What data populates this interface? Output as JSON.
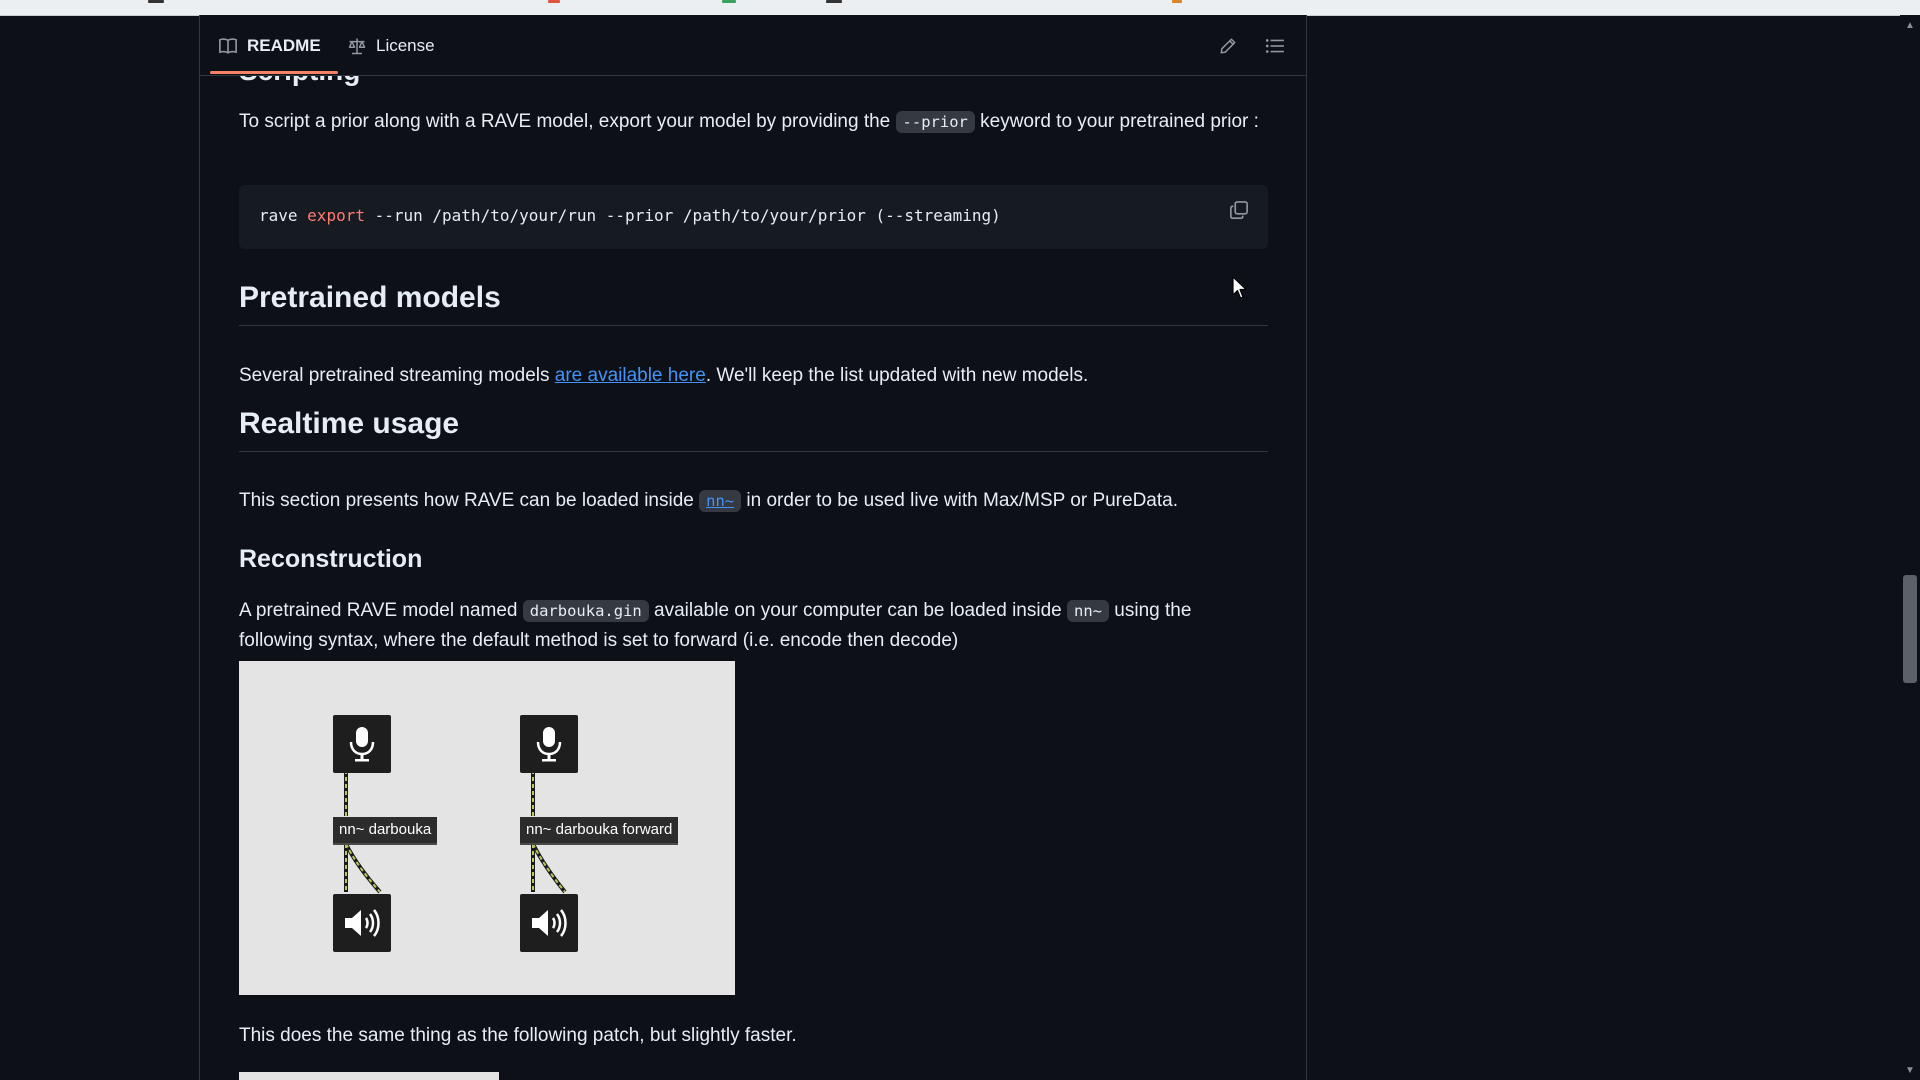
{
  "tabs": {
    "readme_label": "README",
    "license_label": "License"
  },
  "toolbar": {
    "edit_icon": "pencil-icon",
    "outline_icon": "list-icon"
  },
  "partial_heading": "Scripting",
  "scripting": {
    "text_before": "To script a prior along with a RAVE model, export your model by providing the ",
    "code": "--prior",
    "text_after": " keyword to your pretrained prior :"
  },
  "code_block": {
    "cmd": "rave",
    "keyword": "export",
    "rest": " --run /path/to/your/run --prior /path/to/your/prior (--streaming)",
    "copy_icon": "copy-icon"
  },
  "pretrained": {
    "heading": "Pretrained models",
    "text_before": "Several pretrained streaming models ",
    "link": "are available here",
    "text_after": ". We'll keep the list updated with new models."
  },
  "realtime": {
    "heading": "Realtime usage",
    "text_before": "This section presents how RAVE can be loaded inside ",
    "link": "nn~",
    "text_after": " in order to be used live with Max/MSP or PureData."
  },
  "reconstruction": {
    "heading": "Reconstruction",
    "text1": "A pretrained RAVE model named ",
    "code1": "darbouka.gin",
    "text2": " available on your computer can be loaded inside ",
    "code2": "nn~",
    "text3": " using the following syntax, where the default method is set to forward (i.e. encode then decode)"
  },
  "patch": {
    "object_left": "nn~ darbouka",
    "object_right": "nn~ darbouka forward",
    "input_icon": "microphone-icon",
    "output_icon": "speaker-icon"
  },
  "after_image_text": "This does the same thing as the following patch, but slightly faster."
}
